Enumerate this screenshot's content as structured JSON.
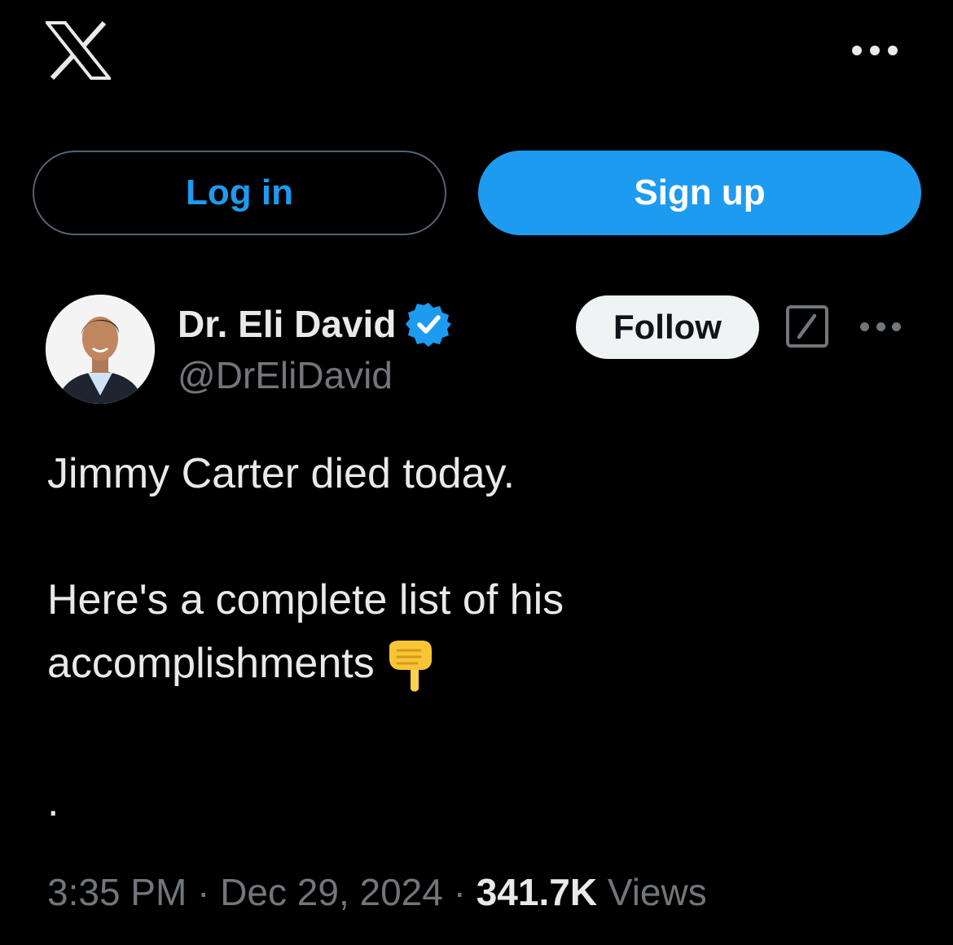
{
  "header": {
    "logo_icon": "x-logo-icon",
    "more_icon": "more-horizontal-icon"
  },
  "auth": {
    "login_label": "Log in",
    "signup_label": "Sign up"
  },
  "tweet": {
    "author": {
      "display_name": "Dr. Eli David",
      "handle": "@DrEliDavid",
      "verified": true
    },
    "follow_label": "Follow",
    "lines": [
      "Jimmy Carter died today.",
      "Here's a complete list of his",
      "accomplishments",
      "."
    ],
    "emoji": "👇",
    "timestamp": "3:35 PM · Dec 29, 2024 · ",
    "views_count": "341.7K",
    "views_label": " Views"
  },
  "colors": {
    "background": "#000000",
    "accent": "#1d9bf0",
    "text_primary": "#e7e9ea",
    "text_secondary": "#71767b",
    "button_light": "#eff3f4"
  }
}
